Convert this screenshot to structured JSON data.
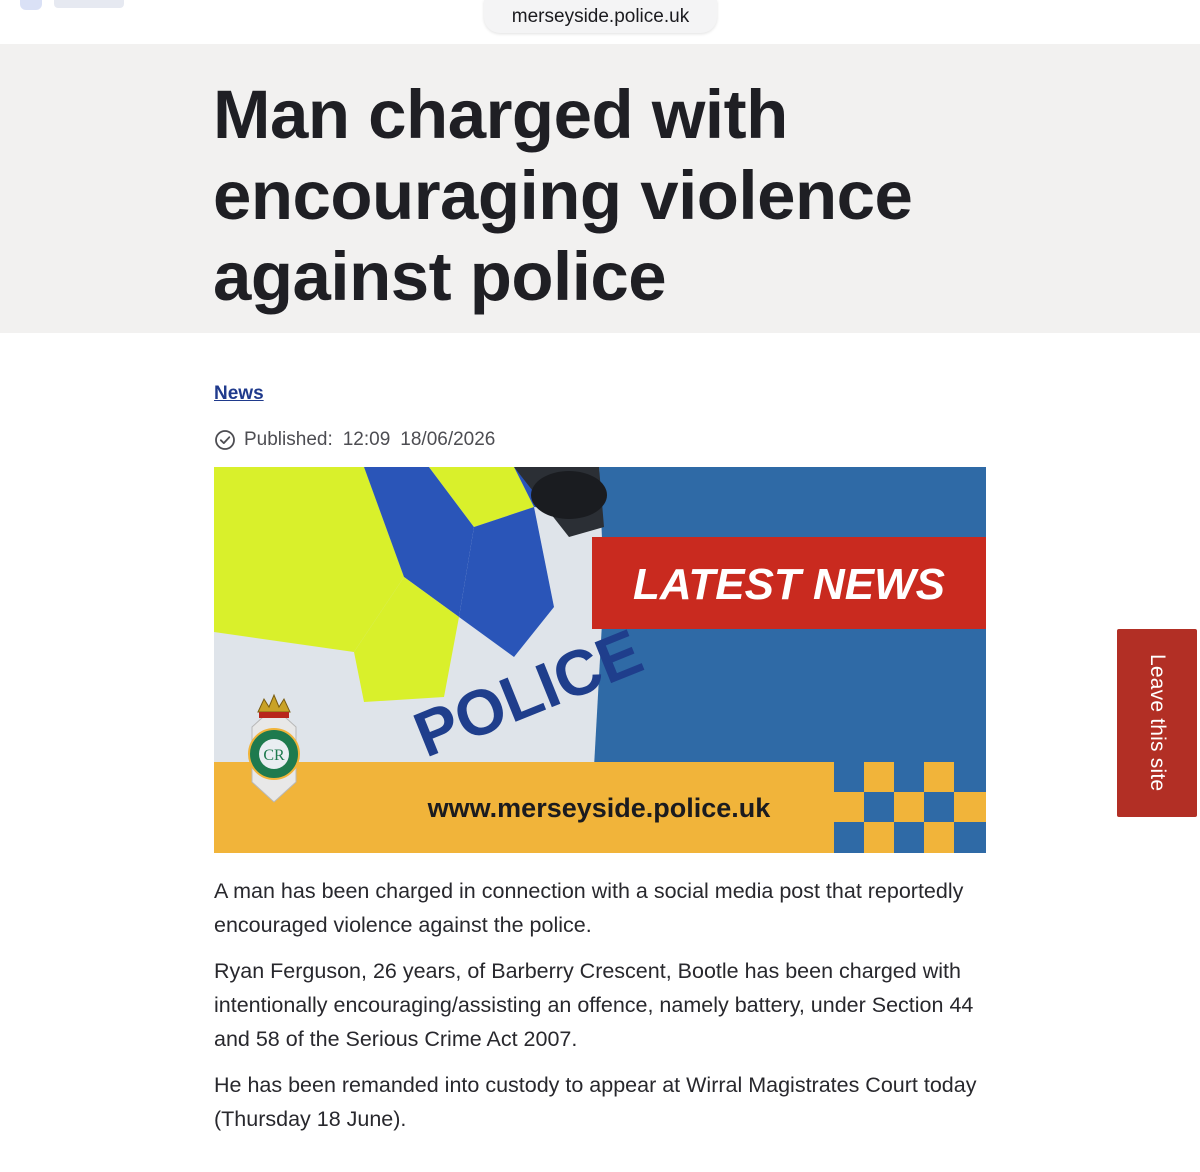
{
  "browser": {
    "url": "merseyside.police.uk"
  },
  "article": {
    "title": "Man charged with encouraging violence against police",
    "category_link": "News",
    "published_label": "Published:",
    "published_time": "12:09",
    "published_date": "18/06/2026",
    "image": {
      "banner_text": "LATEST NEWS",
      "vehicle_text": "POLICE",
      "website_text": "www.merseyside.police.uk",
      "badge_text": "MERSEYSIDE POLICE",
      "colors": {
        "blue": "#2f6aa6",
        "red": "#c92a1f",
        "yellow": "#f1b43a",
        "hi_vis": "#d9f02b"
      }
    },
    "paragraphs": [
      "A man has been charged in connection with a social media post that reportedly encouraged violence against the police.",
      "Ryan Ferguson, 26 years, of Barberry Crescent, Bootle has been charged with intentionally encouraging/assisting an offence, namely battery, under Section 44 and 58 of the Serious Crime Act 2007.",
      "He has been remanded into custody to appear at Wirral Magistrates Court today (Thursday 18 June)."
    ]
  },
  "leave_site": {
    "label": "Leave this site",
    "color": "#b22f25"
  },
  "icons": {
    "published": "check-circle-icon"
  }
}
